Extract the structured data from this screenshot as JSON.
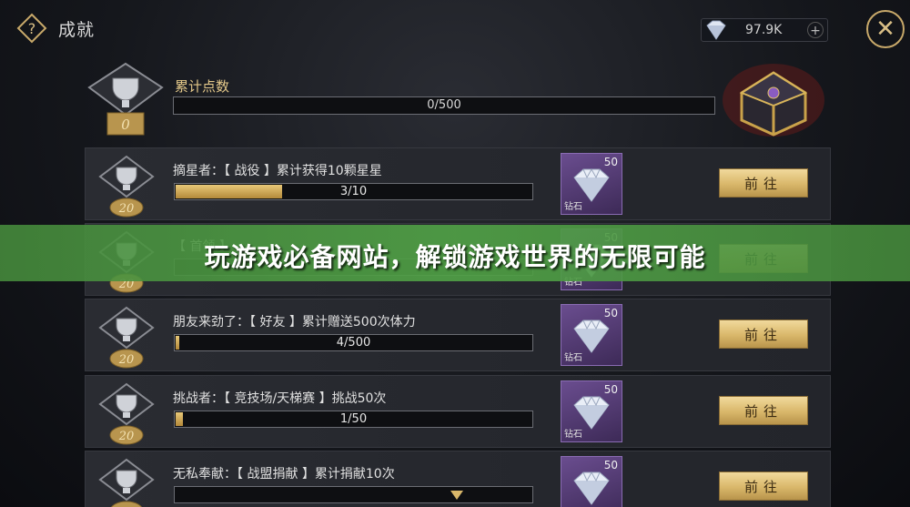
{
  "header": {
    "title": "成就",
    "currency_amount": "97.9K",
    "currency_plus": "+",
    "close_glyph": "✕"
  },
  "summary": {
    "label": "累计点数",
    "badge_value": "0",
    "progress_text": "0/500",
    "progress_fraction": 0
  },
  "achievements": [
    {
      "title": "摘星者：【 战役 】累计获得10颗星星",
      "badge": "20",
      "progress_text": "3/10",
      "progress_fraction": 0.3,
      "reward_qty": "50",
      "reward_name": "钻石",
      "button": "前往"
    },
    {
      "title": "【 首领 】",
      "badge": "20",
      "progress_text": "",
      "progress_fraction": 0,
      "reward_qty": "50",
      "reward_name": "钻石",
      "button": "前往"
    },
    {
      "title": "朋友来劲了：【 好友 】累计赠送500次体力",
      "badge": "20",
      "progress_text": "4/500",
      "progress_fraction": 0.008,
      "reward_qty": "50",
      "reward_name": "钻石",
      "button": "前往"
    },
    {
      "title": "挑战者：【 竞技场/天梯赛 】挑战50次",
      "badge": "20",
      "progress_text": "1/50",
      "progress_fraction": 0.02,
      "reward_qty": "50",
      "reward_name": "钻石",
      "button": "前往"
    },
    {
      "title": "无私奉献：【 战盟捐献 】累计捐献10次",
      "badge": "",
      "progress_text": "",
      "progress_fraction": 0,
      "reward_qty": "50",
      "reward_name": "",
      "button": "前往"
    }
  ],
  "banner": {
    "text": "玩游戏必备网站，解锁游戏世界的无限可能"
  },
  "colors": {
    "gold": "#d9b76a",
    "banner_green": "#4f9a45",
    "reward_purple": "#5a3f7d"
  }
}
